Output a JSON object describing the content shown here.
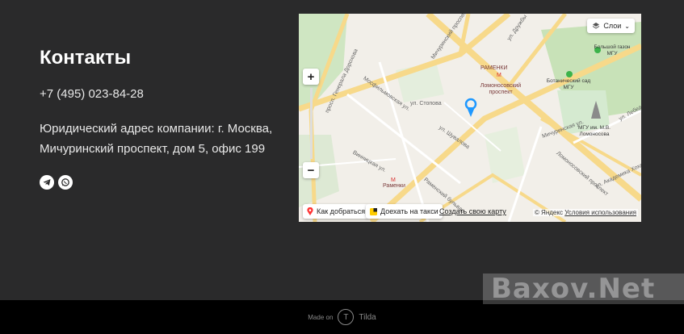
{
  "contacts": {
    "title": "Контакты",
    "phone": "+7 (495) 023-84-28",
    "address_line1": "Юридический адрес компании: г. Москва,",
    "address_line2": "Мичуринский проспект, дом 5, офис 199",
    "social_icons": [
      "telegram-icon",
      "whatsapp-icon"
    ]
  },
  "map": {
    "layers_label": "Слои",
    "route_label": "Как добраться",
    "taxi_label": "Доехать на такси",
    "create_map_link": "Создать свою карту",
    "copyright": "© Яндекс",
    "terms_link": "Условия использования",
    "metro": [
      "РАМЕНКИ",
      "Ломоносовский проспект",
      "Раменки"
    ],
    "pois": [
      "Большой газон МГУ",
      "Ботанический сад МГУ",
      "МГУ им. М.В. Ломоносова"
    ],
    "streets": [
      "ул. Стопова",
      "Мосфильмовская ул.",
      "просп. Генерала Дорохова",
      "Винницкая ул.",
      "ул. Шувалова",
      "Раменский бульвар",
      "Ломоносовский проспект",
      "Мичуринский проспект",
      "ул. Дружбы",
      "Мичуринская ул.",
      "ул. Академика Хохлова",
      "ул. Лебед"
    ]
  },
  "footer": {
    "made_on": "Made on",
    "brand": "Tilda"
  },
  "watermark": "Baxov.Net"
}
